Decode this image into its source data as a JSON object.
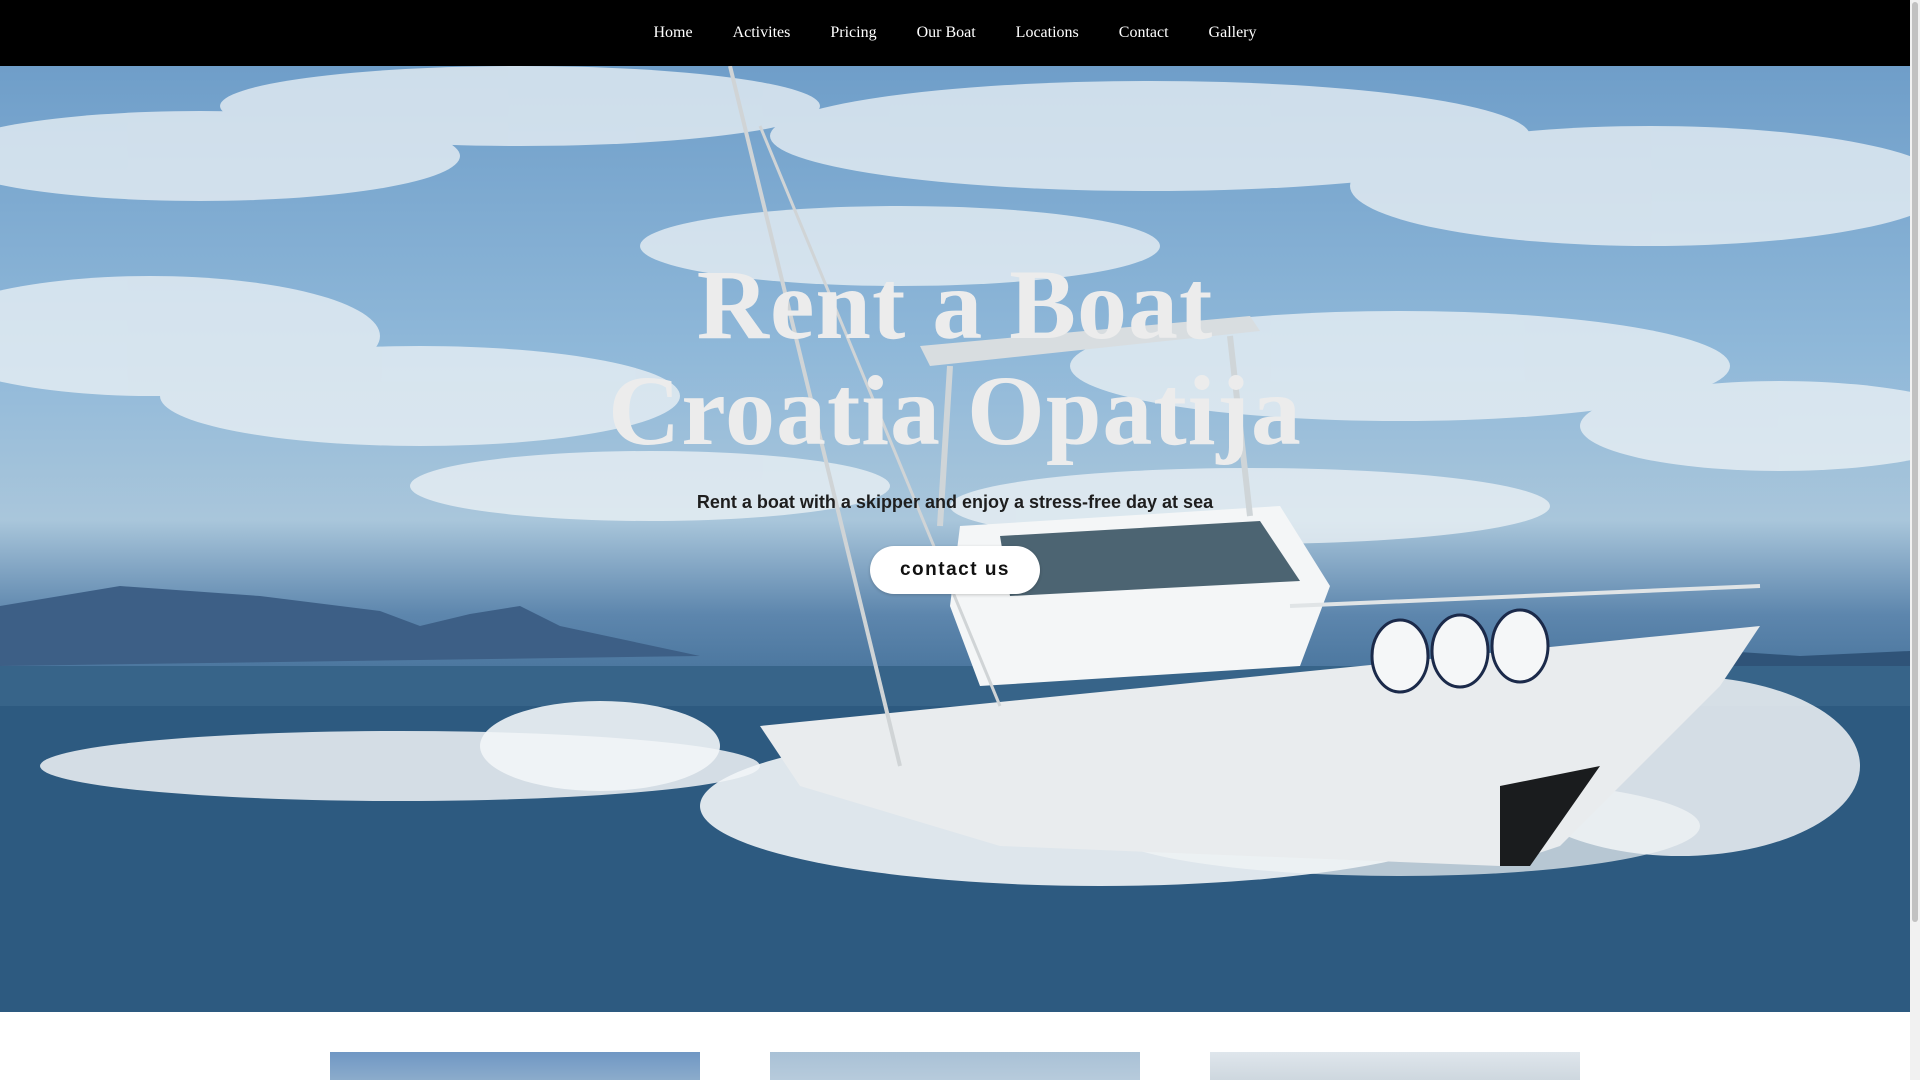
{
  "nav": {
    "items": [
      {
        "label": "Home"
      },
      {
        "label": "Activites"
      },
      {
        "label": "Pricing"
      },
      {
        "label": "Our Boat"
      },
      {
        "label": "Locations"
      },
      {
        "label": "Contact"
      },
      {
        "label": "Gallery"
      }
    ]
  },
  "hero": {
    "title_line1": "Rent a Boat",
    "title_line2": "Croatia Opatija",
    "subtitle": "Rent a boat with a skipper and enjoy a stress-free day at sea",
    "cta_label": "contact us"
  },
  "colors": {
    "nav_background": "#000000",
    "nav_text": "#ffffff",
    "title_text": "#ececec",
    "cta_background": "#ffffff"
  }
}
